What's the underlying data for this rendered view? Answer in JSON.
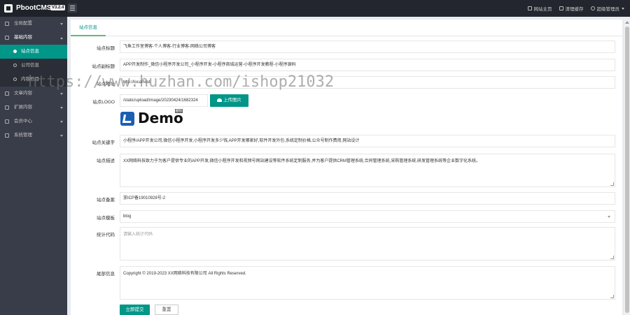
{
  "header": {
    "logo_text": "PbootCMS",
    "version": "V3.2.4",
    "links": [
      {
        "label": "网站主页",
        "icon": "home-icon"
      },
      {
        "label": "清理缓存",
        "icon": "trash-icon"
      },
      {
        "label": "超级管理员",
        "icon": "user-icon"
      }
    ]
  },
  "sidebar": {
    "items": [
      {
        "label": "全局配置",
        "icon": "gear-icon"
      },
      {
        "label": "基础内容",
        "icon": "list-icon",
        "open": true,
        "children": [
          {
            "label": "站点信息",
            "active": true
          },
          {
            "label": "公司信息"
          },
          {
            "label": "内容栏目"
          }
        ]
      },
      {
        "label": "文章内容",
        "icon": "file-icon"
      },
      {
        "label": "扩展内容",
        "icon": "puzzle-icon"
      },
      {
        "label": "会员中心",
        "icon": "member-icon"
      },
      {
        "label": "系统管理",
        "icon": "settings-icon"
      }
    ]
  },
  "tabs": [
    {
      "label": "站点信息"
    }
  ],
  "form": {
    "title_label": "站点标题",
    "title_value": "飞鱼工作室博客-个人博客-行业博客-网络公司博客",
    "subtitle_label": "站点副标题",
    "subtitle_value": "APP开发制作_微信小程序开发公司_小程序开发-小程序商城运营-小程序开发教程-小程序源码",
    "domain_label": "站点地址",
    "domain_value": "http://localhost",
    "logo_label": "站点LOGO",
    "logo_value": "/static/upload/image/20230424/1682324",
    "upload_label": "上传图片",
    "logo_preview_text": "Demo",
    "logo_preview_badge": "删除",
    "keywords_label": "站点关键字",
    "keywords_value": "小程序/APP开发公司,微信小程序开发,小程序开发多少钱,APP开发哪家好,软件开发外包,系统定制价格,公众号制作费用,网站设计",
    "desc_label": "站点描述",
    "desc_value": "XX网络科技致力于为客户提供专业的APP开发,微信小程序开发和视频号网站建设等软件系统定制服务,并为客户提供CRM管理系统,合同管理系统,采购管理系统,研发管理系统等企业数字化系统。",
    "icp_label": "站点备案",
    "icp_value": "浙ICP备19010928号-2",
    "template_label": "站点模板",
    "template_value": "blog",
    "stat_label": "统计代码",
    "stat_placeholder": "请输入统计代码",
    "footer_label": "尾部信息",
    "footer_value": "Copyright © 2019-2023 XX网络科技有限公司 All Rights Reserved.",
    "submit_label": "立即提交",
    "reset_label": "重置"
  },
  "watermark": "https://www.huzhan.com/ishop21032"
}
